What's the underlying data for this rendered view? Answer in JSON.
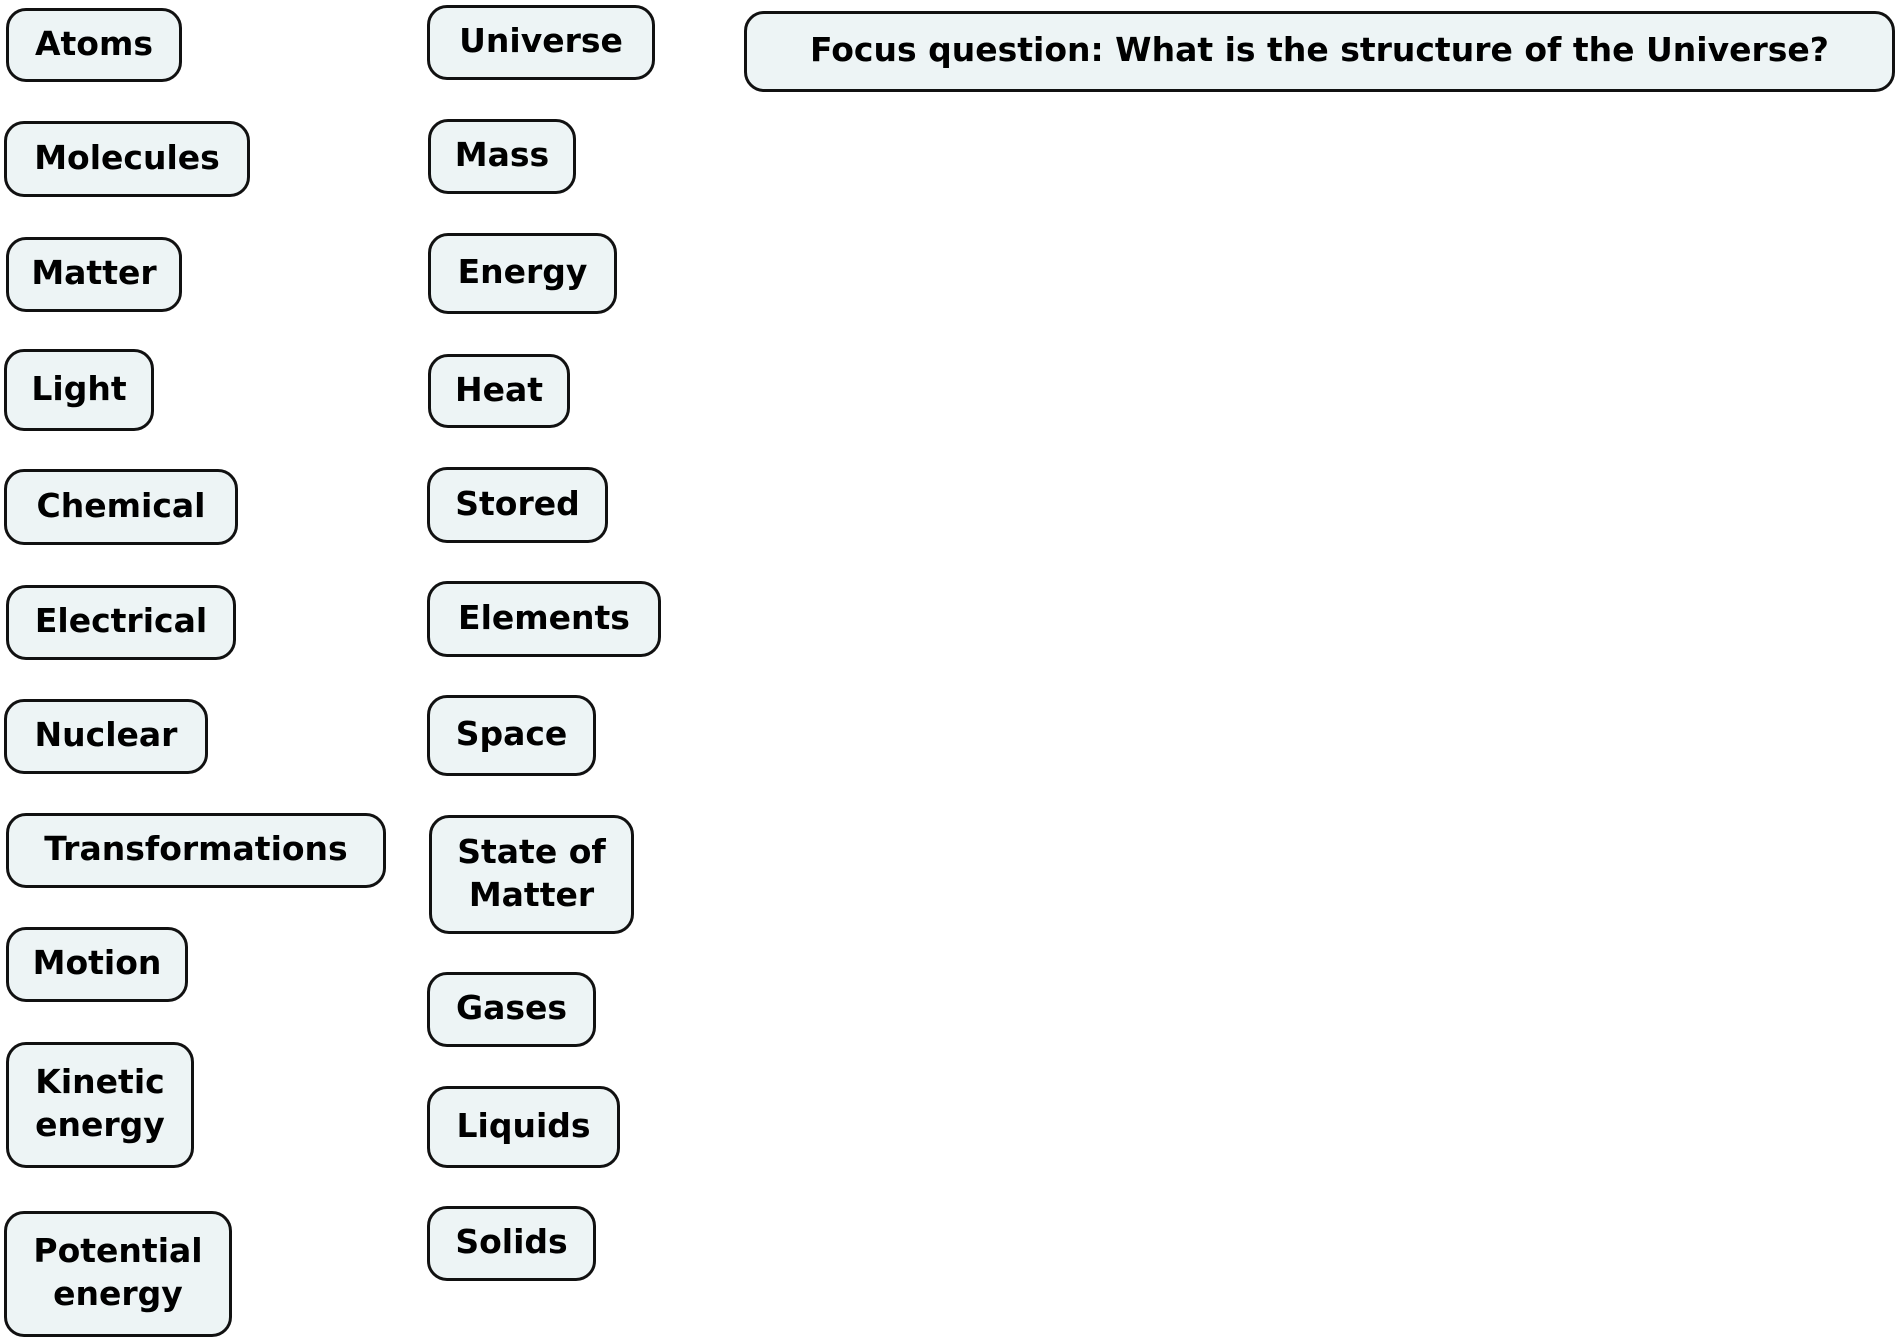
{
  "colors": {
    "node_fill": "#edf4f5",
    "node_border": "#111111",
    "text": "#000000"
  },
  "focus_question": "Focus question: What is the structure of the Universe?",
  "concepts": {
    "column1": [
      "Atoms",
      "Molecules",
      "Matter",
      "Light",
      "Chemical",
      "Electrical",
      "Nuclear",
      "Transformations",
      "Motion",
      "Kinetic\nenergy",
      "Potential\nenergy"
    ],
    "column2": [
      "Universe",
      "Mass",
      "Energy",
      "Heat",
      "Stored",
      "Elements",
      "Space",
      "State of\nMatter",
      "Gases",
      "Liquids",
      "Solids"
    ]
  }
}
